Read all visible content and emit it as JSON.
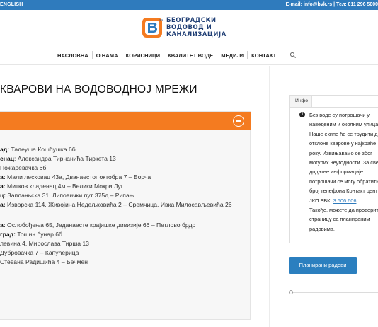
{
  "topbar": {
    "language": "ENGLISH",
    "contact": "E-mail: info@bvk.rs | Тел: 011 296 5000"
  },
  "brand": {
    "name_line1": "БЕОГРАДСКИ",
    "name_line2": "ВОДОВОД И",
    "name_line3": "КАНАЛИЗАЦИЈА",
    "year": "1892",
    "colors": {
      "orange": "#f47b20",
      "blue": "#2f7bbd",
      "navy": "#1f3e74"
    }
  },
  "nav": {
    "items": [
      "НАСЛОВНА",
      "О НАМА",
      "КОРИСНИЦИ",
      "КВАЛИТЕТ ВОДЕ",
      "МЕДИЈИ",
      "КОНТАКТ"
    ],
    "search_icon": "search-icon"
  },
  "page": {
    "title": "КВАРОВИ НА ВОДОВОДНОЈ МРЕЖИ"
  },
  "outages": {
    "group1": [
      {
        "area": "ад:",
        "streets": " Тадеуша Кошћушка 6б"
      },
      {
        "area": "енац",
        "streets": ": Александра Тирнанића Тиркета 13"
      },
      {
        "area": "",
        "streets": "Пожаревачка 6б"
      },
      {
        "area": "а:",
        "streets": " Мали лесковац 43а, Дванаестог октобра 7 – Борча"
      },
      {
        "area": "а:",
        "streets": " Митков кладенац 4м – Велики Мокри Луг"
      },
      {
        "area": "ц:",
        "streets": " Запланьска 31, Липовички пут 375д – Рипањ"
      },
      {
        "area": "а:",
        "streets": " Изворска 114, Живојина Недељковића 2 – Сремчица, Ивка Милосављевића 26"
      }
    ],
    "group2": [
      {
        "area": "а:",
        "streets": " Ослобођења 65, Једанаесте крајишке дивизије 66 – Петлово брдо"
      },
      {
        "area": "град:",
        "streets": " Тошин бунар 6б"
      },
      {
        "area": "",
        "streets": "левина 4, Мирослава Тирша 13"
      },
      {
        "area": "",
        "streets": "Дубровачка 7 – Капућерица"
      },
      {
        "area": "",
        "streets": "Стевана Радишића 4 – Бечмен"
      }
    ]
  },
  "sidebar": {
    "info_tab": "Инфо",
    "info_icon": "info-icon",
    "info_lines": [
      "Без воде су потрошачи у",
      "наведеним и околним улица",
      "Наше екипе ће се трудити д",
      "отклоне кварове у најкраће",
      "року. Извињавамо се због",
      "могућих неугодности. За све",
      "додатне информације",
      "потрошачи се могу обратити",
      "број телефона Контакт цент"
    ],
    "info_line_jkp": "ЈКП БВК:",
    "phone": "3 606 606",
    "info_tail": [
      "Такође, можете да проверит",
      "страницу са планираним",
      "радовима."
    ],
    "button_label": "Планирани радови"
  }
}
